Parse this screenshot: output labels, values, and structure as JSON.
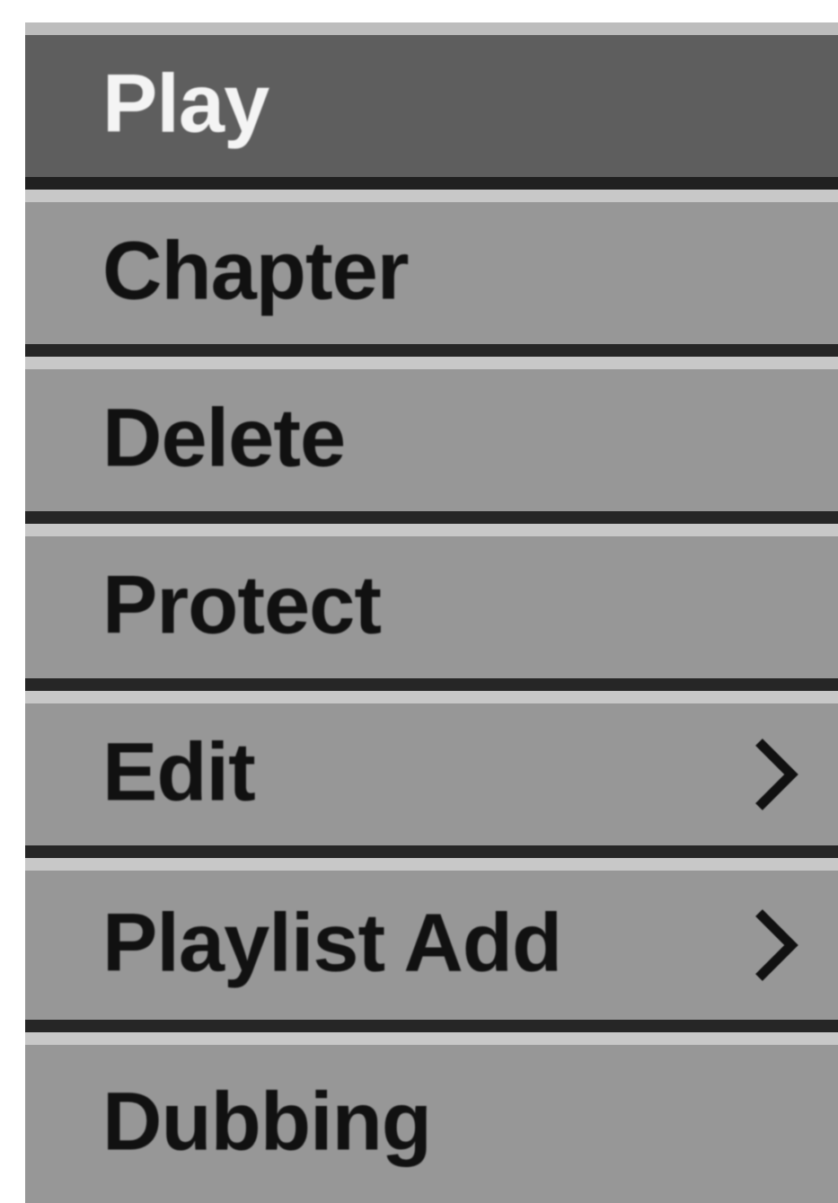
{
  "menu": {
    "items": [
      {
        "label": "Play",
        "selected": true,
        "has_submenu": false
      },
      {
        "label": "Chapter",
        "selected": false,
        "has_submenu": false
      },
      {
        "label": "Delete",
        "selected": false,
        "has_submenu": false
      },
      {
        "label": "Protect",
        "selected": false,
        "has_submenu": false
      },
      {
        "label": "Edit",
        "selected": false,
        "has_submenu": true,
        "icon": "chevron-right-icon"
      },
      {
        "label": "Playlist Add",
        "selected": false,
        "has_submenu": true,
        "icon": "chevron-right-icon"
      },
      {
        "label": "Dubbing",
        "selected": false,
        "has_submenu": false
      }
    ]
  },
  "colors": {
    "item_background": "#979797",
    "selected_background": "#5e5e5e",
    "item_text": "#111111",
    "selected_text": "#f4f4f4"
  }
}
